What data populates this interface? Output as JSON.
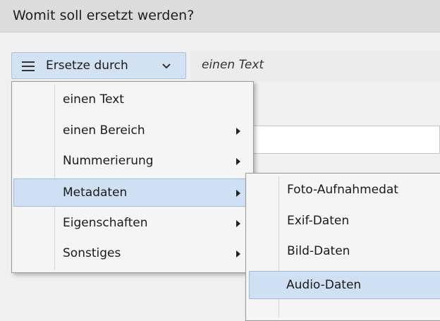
{
  "dialog": {
    "title": "Womit soll ersetzt werden?"
  },
  "toolbar": {
    "replace_button_label": "Ersetze durch",
    "current_value": "einen Text",
    "menu_icon": "hamburger-icon",
    "dropdown_icon": "chevron-down-icon"
  },
  "menu": {
    "items": [
      {
        "label": "einen Text",
        "submenu": false
      },
      {
        "label": "einen Bereich",
        "submenu": true
      },
      {
        "label": "Nummerierung",
        "submenu": true
      },
      {
        "label": "Metadaten",
        "submenu": true,
        "selected": true
      },
      {
        "label": "Eigenschaften",
        "submenu": true
      },
      {
        "label": "Sonstiges",
        "submenu": true
      }
    ]
  },
  "submenu": {
    "items": [
      {
        "label": "Foto-Aufnahmedat"
      },
      {
        "label": "Exif-Daten"
      },
      {
        "label": "Bild-Daten"
      },
      {
        "label": "Audio-Daten",
        "selected": true
      }
    ]
  },
  "colors": {
    "selection": "#cfe0f4",
    "selection_border": "#9dbde0",
    "header_bg": "#dcdcdc"
  }
}
